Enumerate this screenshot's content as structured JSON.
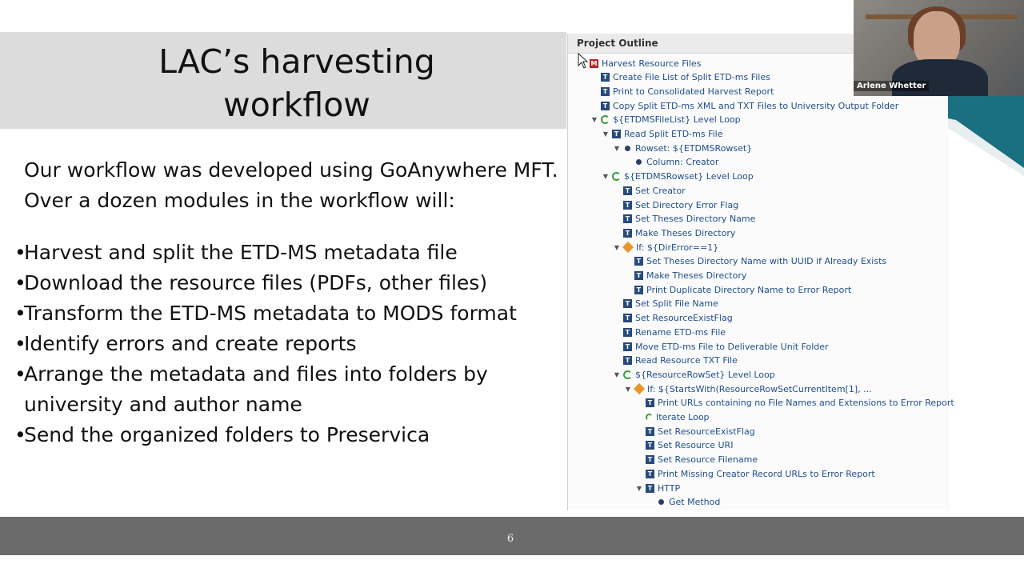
{
  "slide": {
    "title_line1": "LAC’s harvesting",
    "title_line2": "workflow",
    "intro": "Our workflow was developed using GoAnywhere MFT. Over a dozen modules in the workflow will:",
    "bullets": [
      "Harvest and split the ETD-MS metadata file",
      "Download the resource files (PDFs, other files)",
      "Transform the ETD-MS metadata to MODS format",
      "Identify errors and create reports",
      "Arrange the metadata and files into folders by university and author name",
      "Send the organized folders to Preservica"
    ],
    "slide_number": "6"
  },
  "outline": {
    "header": "Project Outline",
    "items": [
      {
        "label": "Harvest Resource Files",
        "icon": "module-icon",
        "twisty": false
      },
      {
        "label": "Create File List of Split ETD-ms Files",
        "icon": "task-icon",
        "twisty": false
      },
      {
        "label": "Print to Consolidated Harvest Report",
        "icon": "task-icon",
        "twisty": false
      },
      {
        "label": "Copy Split ETD-ms XML and TXT Files to University Output Folder",
        "icon": "task-icon",
        "twisty": false
      },
      {
        "label": "${ETDMSFileList} Level Loop",
        "icon": "loop-icon",
        "twisty": true
      },
      {
        "label": "Read Split ETD-ms File",
        "icon": "task-icon",
        "twisty": true
      },
      {
        "label": "Rowset: ${ETDMSRowset}",
        "icon": "dot-icon",
        "twisty": true
      },
      {
        "label": "Column: Creator",
        "icon": "dot-icon",
        "twisty": false
      },
      {
        "label": "${ETDMSRowset} Level Loop",
        "icon": "loop-icon",
        "twisty": true
      },
      {
        "label": "Set Creator",
        "icon": "task-icon",
        "twisty": false
      },
      {
        "label": "Set Directory Error Flag",
        "icon": "task-icon",
        "twisty": false
      },
      {
        "label": "Set Theses Directory Name",
        "icon": "task-icon",
        "twisty": false
      },
      {
        "label": "Make Theses Directory",
        "icon": "task-icon",
        "twisty": false
      },
      {
        "label": "If: ${DirError==1}",
        "icon": "if-icon",
        "twisty": true
      },
      {
        "label": "Set Theses Directory Name with UUID if Already Exists",
        "icon": "task-icon",
        "twisty": false
      },
      {
        "label": "Make Theses Directory",
        "icon": "task-icon",
        "twisty": false
      },
      {
        "label": "Print Duplicate Directory Name to Error Report",
        "icon": "task-icon",
        "twisty": false
      },
      {
        "label": "Set Split File Name",
        "icon": "task-icon",
        "twisty": false
      },
      {
        "label": "Set ResourceExistFlag",
        "icon": "task-icon",
        "twisty": false
      },
      {
        "label": "Rename ETD-ms File",
        "icon": "task-icon",
        "twisty": false
      },
      {
        "label": "Move ETD-ms File to Deliverable Unit Folder",
        "icon": "task-icon",
        "twisty": false
      },
      {
        "label": "Read Resource TXT File",
        "icon": "task-icon",
        "twisty": false
      },
      {
        "label": "${ResourceRowSet} Level Loop",
        "icon": "loop-icon",
        "twisty": true
      },
      {
        "label": "If: ${StartsWith(ResourceRowSetCurrentItem[1], ...",
        "icon": "if-icon",
        "twisty": true
      },
      {
        "label": "Print URLs containing no File Names and Extensions to Error Report",
        "icon": "task-icon",
        "twisty": false
      },
      {
        "label": "Iterate Loop",
        "icon": "iterate-icon",
        "twisty": false
      },
      {
        "label": "Set ResourceExistFlag",
        "icon": "task-icon",
        "twisty": false
      },
      {
        "label": "Set Resource URI",
        "icon": "task-icon",
        "twisty": false
      },
      {
        "label": "Set Resource Filename",
        "icon": "task-icon",
        "twisty": false
      },
      {
        "label": "Print Missing Creator Record URLs to Error Report",
        "icon": "task-icon",
        "twisty": false
      },
      {
        "label": "HTTP",
        "icon": "task-icon",
        "twisty": true
      },
      {
        "label": "Get Method",
        "icon": "dot-icon",
        "twisty": false
      }
    ]
  },
  "video": {
    "participant_name": "Arlene Whetter"
  },
  "colors": {
    "accent_teal": "#1a6f80",
    "tree_text": "#1f4e8a",
    "footer": "#6b6b6b"
  }
}
